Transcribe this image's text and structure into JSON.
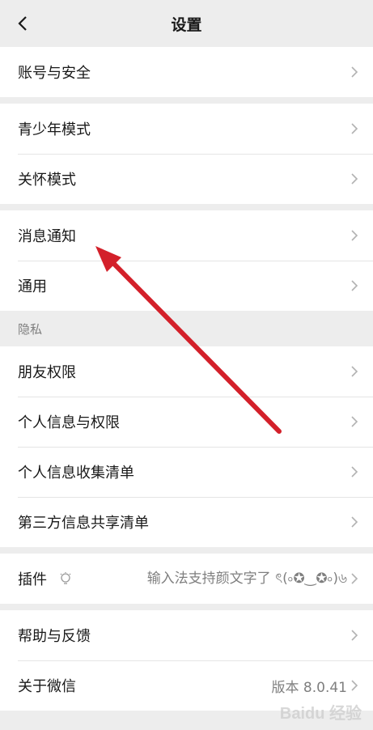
{
  "header": {
    "title": "设置"
  },
  "groups": {
    "account": {
      "label": "账号与安全"
    },
    "modes": {
      "teen": "青少年模式",
      "care": "关怀模式"
    },
    "general": {
      "notify": "消息通知",
      "common": "通用"
    },
    "privacy": {
      "section": "隐私",
      "friends": "朋友权限",
      "personal": "个人信息与权限",
      "collect": "个人信息收集清单",
      "thirdparty": "第三方信息共享清单"
    },
    "plugins": {
      "label": "插件",
      "value": "输入法支持颜文字了 ৎ(৹✪‿✪৹)৬"
    },
    "about": {
      "help": "帮助与反馈",
      "about": "关于微信",
      "version": "版本 8.0.41"
    }
  },
  "watermark": "Baidu 经验"
}
